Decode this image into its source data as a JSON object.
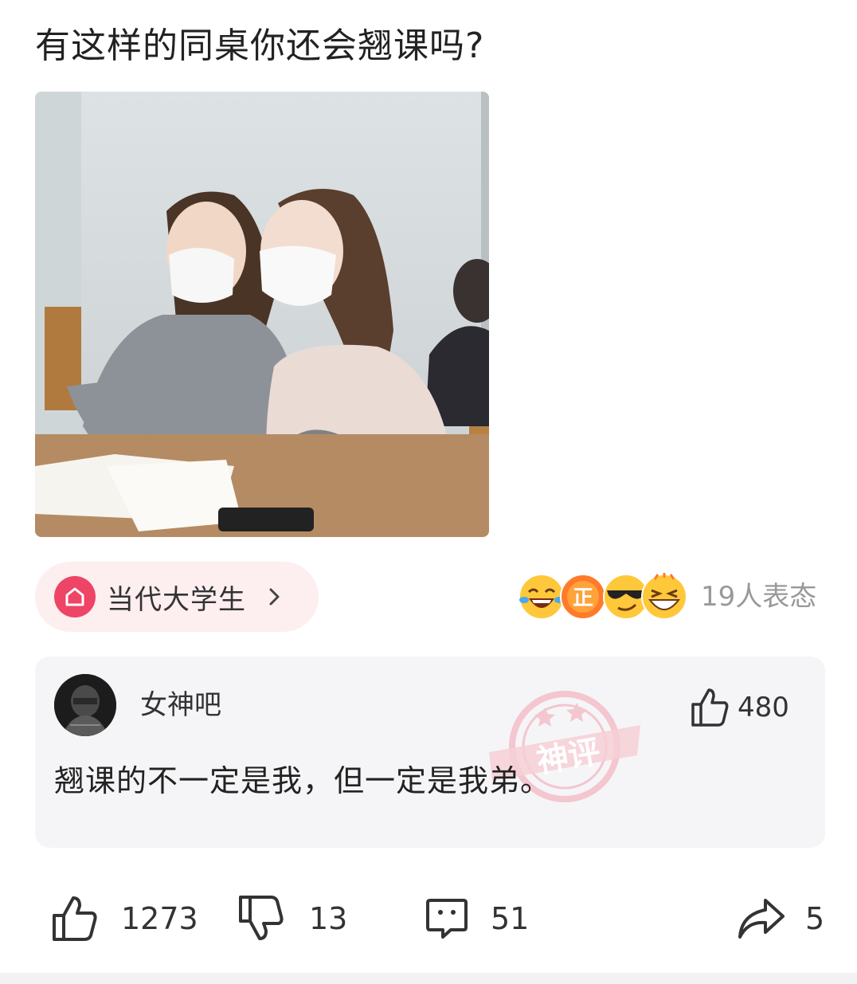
{
  "post": {
    "title": "有这样的同桌你还会翘课吗?"
  },
  "topic": {
    "label": "当代大学生",
    "icon": "home-icon"
  },
  "reactions": {
    "emojis": [
      "laughing-tears-emoji",
      "zheng-badge-emoji",
      "sunglasses-emoji",
      "grinning-emoji"
    ],
    "count_text": "19人表态"
  },
  "comment": {
    "username": "女神吧",
    "likes": "480",
    "text": "翘课的不一定是我，但一定是我弟。",
    "stamp": "神评"
  },
  "actions": {
    "likes": "1273",
    "dislikes": "13",
    "comments": "51",
    "shares": "5"
  },
  "colors": {
    "accent": "#ee4466",
    "chip_bg": "#fdeef0",
    "card_bg": "#f5f5f7",
    "muted": "#999999"
  }
}
